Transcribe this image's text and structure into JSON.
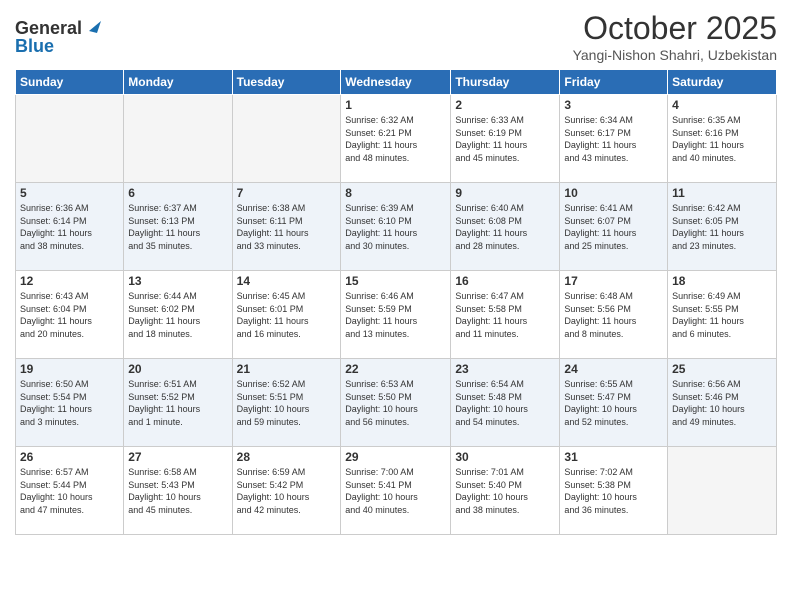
{
  "header": {
    "logo_general": "General",
    "logo_blue": "Blue",
    "title": "October 2025",
    "location": "Yangi-Nishon Shahri, Uzbekistan"
  },
  "weekdays": [
    "Sunday",
    "Monday",
    "Tuesday",
    "Wednesday",
    "Thursday",
    "Friday",
    "Saturday"
  ],
  "weeks": [
    [
      {
        "day": "",
        "info": ""
      },
      {
        "day": "",
        "info": ""
      },
      {
        "day": "",
        "info": ""
      },
      {
        "day": "1",
        "info": "Sunrise: 6:32 AM\nSunset: 6:21 PM\nDaylight: 11 hours\nand 48 minutes."
      },
      {
        "day": "2",
        "info": "Sunrise: 6:33 AM\nSunset: 6:19 PM\nDaylight: 11 hours\nand 45 minutes."
      },
      {
        "day": "3",
        "info": "Sunrise: 6:34 AM\nSunset: 6:17 PM\nDaylight: 11 hours\nand 43 minutes."
      },
      {
        "day": "4",
        "info": "Sunrise: 6:35 AM\nSunset: 6:16 PM\nDaylight: 11 hours\nand 40 minutes."
      }
    ],
    [
      {
        "day": "5",
        "info": "Sunrise: 6:36 AM\nSunset: 6:14 PM\nDaylight: 11 hours\nand 38 minutes."
      },
      {
        "day": "6",
        "info": "Sunrise: 6:37 AM\nSunset: 6:13 PM\nDaylight: 11 hours\nand 35 minutes."
      },
      {
        "day": "7",
        "info": "Sunrise: 6:38 AM\nSunset: 6:11 PM\nDaylight: 11 hours\nand 33 minutes."
      },
      {
        "day": "8",
        "info": "Sunrise: 6:39 AM\nSunset: 6:10 PM\nDaylight: 11 hours\nand 30 minutes."
      },
      {
        "day": "9",
        "info": "Sunrise: 6:40 AM\nSunset: 6:08 PM\nDaylight: 11 hours\nand 28 minutes."
      },
      {
        "day": "10",
        "info": "Sunrise: 6:41 AM\nSunset: 6:07 PM\nDaylight: 11 hours\nand 25 minutes."
      },
      {
        "day": "11",
        "info": "Sunrise: 6:42 AM\nSunset: 6:05 PM\nDaylight: 11 hours\nand 23 minutes."
      }
    ],
    [
      {
        "day": "12",
        "info": "Sunrise: 6:43 AM\nSunset: 6:04 PM\nDaylight: 11 hours\nand 20 minutes."
      },
      {
        "day": "13",
        "info": "Sunrise: 6:44 AM\nSunset: 6:02 PM\nDaylight: 11 hours\nand 18 minutes."
      },
      {
        "day": "14",
        "info": "Sunrise: 6:45 AM\nSunset: 6:01 PM\nDaylight: 11 hours\nand 16 minutes."
      },
      {
        "day": "15",
        "info": "Sunrise: 6:46 AM\nSunset: 5:59 PM\nDaylight: 11 hours\nand 13 minutes."
      },
      {
        "day": "16",
        "info": "Sunrise: 6:47 AM\nSunset: 5:58 PM\nDaylight: 11 hours\nand 11 minutes."
      },
      {
        "day": "17",
        "info": "Sunrise: 6:48 AM\nSunset: 5:56 PM\nDaylight: 11 hours\nand 8 minutes."
      },
      {
        "day": "18",
        "info": "Sunrise: 6:49 AM\nSunset: 5:55 PM\nDaylight: 11 hours\nand 6 minutes."
      }
    ],
    [
      {
        "day": "19",
        "info": "Sunrise: 6:50 AM\nSunset: 5:54 PM\nDaylight: 11 hours\nand 3 minutes."
      },
      {
        "day": "20",
        "info": "Sunrise: 6:51 AM\nSunset: 5:52 PM\nDaylight: 11 hours\nand 1 minute."
      },
      {
        "day": "21",
        "info": "Sunrise: 6:52 AM\nSunset: 5:51 PM\nDaylight: 10 hours\nand 59 minutes."
      },
      {
        "day": "22",
        "info": "Sunrise: 6:53 AM\nSunset: 5:50 PM\nDaylight: 10 hours\nand 56 minutes."
      },
      {
        "day": "23",
        "info": "Sunrise: 6:54 AM\nSunset: 5:48 PM\nDaylight: 10 hours\nand 54 minutes."
      },
      {
        "day": "24",
        "info": "Sunrise: 6:55 AM\nSunset: 5:47 PM\nDaylight: 10 hours\nand 52 minutes."
      },
      {
        "day": "25",
        "info": "Sunrise: 6:56 AM\nSunset: 5:46 PM\nDaylight: 10 hours\nand 49 minutes."
      }
    ],
    [
      {
        "day": "26",
        "info": "Sunrise: 6:57 AM\nSunset: 5:44 PM\nDaylight: 10 hours\nand 47 minutes."
      },
      {
        "day": "27",
        "info": "Sunrise: 6:58 AM\nSunset: 5:43 PM\nDaylight: 10 hours\nand 45 minutes."
      },
      {
        "day": "28",
        "info": "Sunrise: 6:59 AM\nSunset: 5:42 PM\nDaylight: 10 hours\nand 42 minutes."
      },
      {
        "day": "29",
        "info": "Sunrise: 7:00 AM\nSunset: 5:41 PM\nDaylight: 10 hours\nand 40 minutes."
      },
      {
        "day": "30",
        "info": "Sunrise: 7:01 AM\nSunset: 5:40 PM\nDaylight: 10 hours\nand 38 minutes."
      },
      {
        "day": "31",
        "info": "Sunrise: 7:02 AM\nSunset: 5:38 PM\nDaylight: 10 hours\nand 36 minutes."
      },
      {
        "day": "",
        "info": ""
      }
    ]
  ]
}
